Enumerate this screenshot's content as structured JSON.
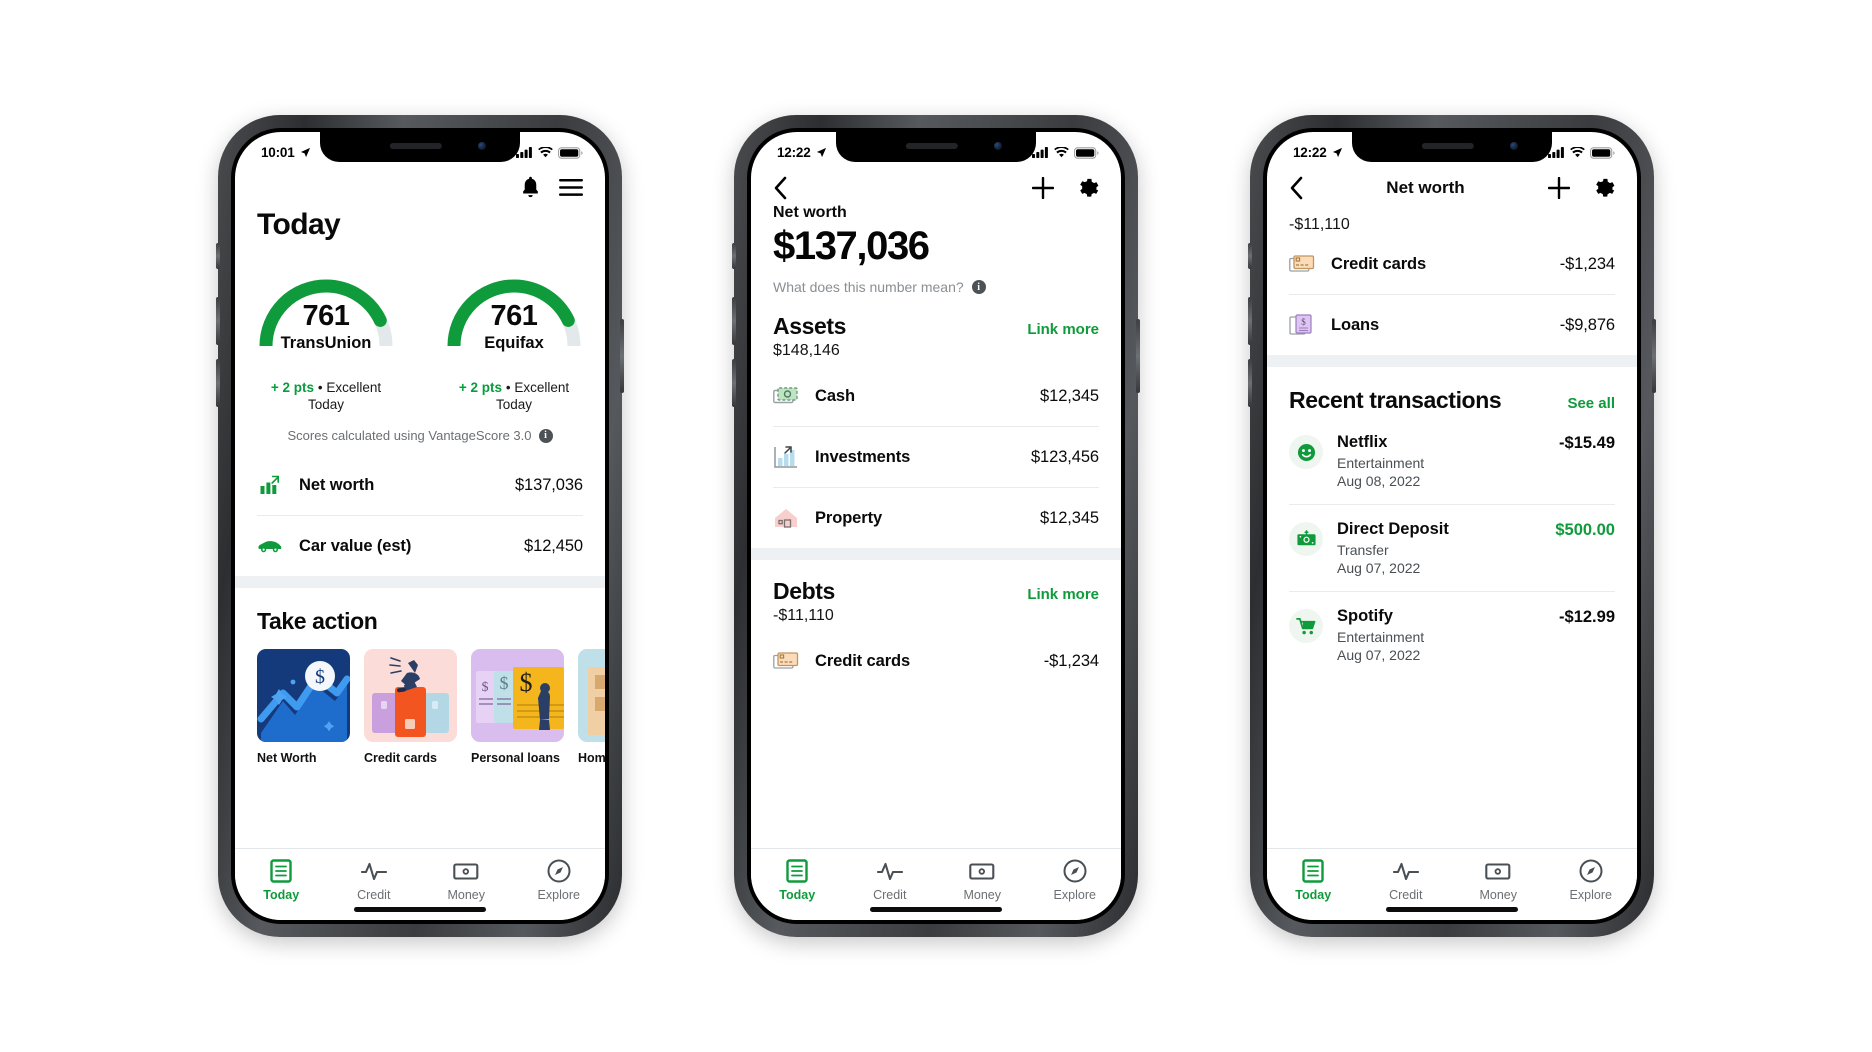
{
  "brand": {
    "green": "#0f9b3b",
    "green_dark": "#089c3c",
    "ink": "#0a0a0a",
    "muted": "#6b6f73",
    "divider": "#e8eaec",
    "section_bg": "#eef1f4"
  },
  "phone1": {
    "status": {
      "time": "10:01",
      "location_icon": "location-arrow-icon",
      "signal_icon": "cellular-signal-icon",
      "wifi_icon": "wifi-icon",
      "battery_icon": "battery-icon"
    },
    "topbar": {
      "bell_icon": "bell-icon",
      "menu_icon": "hamburger-menu-icon"
    },
    "title": "Today",
    "scores": [
      {
        "value": "761",
        "bureau": "TransUnion",
        "delta": "+ 2 pts",
        "separator": "•",
        "rating": "Excellent",
        "when": "Today",
        "percent": 86
      },
      {
        "value": "761",
        "bureau": "Equifax",
        "delta": "+ 2 pts",
        "separator": "•",
        "rating": "Excellent",
        "when": "Today",
        "percent": 86
      }
    ],
    "disclaimer": {
      "text": "Scores calculated using VantageScore 3.0",
      "icon": "info-icon",
      "glyph": "i"
    },
    "rows": [
      {
        "icon": "bar-chart-icon",
        "label": "Net worth",
        "value": "$137,036"
      },
      {
        "icon": "car-icon",
        "label": "Car value (est)",
        "value": "$12,450"
      }
    ],
    "take_action": {
      "title": "Take action",
      "cards": [
        {
          "label": "Net Worth",
          "art": "net-worth-chart-illustration"
        },
        {
          "label": "Credit cards",
          "art": "credit-cards-illustration"
        },
        {
          "label": "Personal loans",
          "art": "personal-loans-illustration"
        },
        {
          "label": "Home lo",
          "art": "home-loans-illustration"
        }
      ]
    },
    "tabs": [
      {
        "label": "Today",
        "icon": "document-icon",
        "active": true
      },
      {
        "label": "Credit",
        "icon": "pulse-icon",
        "active": false
      },
      {
        "label": "Money",
        "icon": "cash-icon",
        "active": false
      },
      {
        "label": "Explore",
        "icon": "compass-icon",
        "active": false
      }
    ]
  },
  "phone2": {
    "status": {
      "time": "12:22",
      "location_icon": "location-arrow-icon",
      "signal_icon": "cellular-signal-icon",
      "wifi_icon": "wifi-icon",
      "battery_icon": "battery-icon"
    },
    "topbar": {
      "back_icon": "back-chevron-icon",
      "plus_icon": "plus-icon",
      "gear_icon": "gear-icon"
    },
    "header": {
      "label": "Net worth",
      "amount": "$137,036",
      "help_text": "What does this number mean?",
      "help_icon": "info-icon",
      "help_glyph": "i"
    },
    "assets": {
      "title": "Assets",
      "link": "Link more",
      "total": "$148,146",
      "rows": [
        {
          "icon": "cash-icon",
          "label": "Cash",
          "value": "$12,345"
        },
        {
          "icon": "investments-chart-icon",
          "label": "Investments",
          "value": "$123,456"
        },
        {
          "icon": "house-icon",
          "label": "Property",
          "value": "$12,345"
        }
      ]
    },
    "debts": {
      "title": "Debts",
      "link": "Link more",
      "total": "-$11,110",
      "rows": [
        {
          "icon": "credit-card-icon",
          "label": "Credit cards",
          "value": "-$1,234"
        }
      ]
    },
    "tabs": [
      {
        "label": "Today",
        "icon": "document-icon",
        "active": true
      },
      {
        "label": "Credit",
        "icon": "pulse-icon",
        "active": false
      },
      {
        "label": "Money",
        "icon": "cash-icon",
        "active": false
      },
      {
        "label": "Explore",
        "icon": "compass-icon",
        "active": false
      }
    ]
  },
  "phone3": {
    "status": {
      "time": "12:22",
      "location_icon": "location-arrow-icon",
      "signal_icon": "cellular-signal-icon",
      "wifi_icon": "wifi-icon",
      "battery_icon": "battery-icon"
    },
    "navbar": {
      "back_icon": "back-chevron-icon",
      "title": "Net worth",
      "plus_icon": "plus-icon",
      "gear_icon": "gear-icon"
    },
    "debts_total": "-$11,110",
    "debt_rows": [
      {
        "icon": "credit-card-icon",
        "label": "Credit cards",
        "value": "-$1,234"
      },
      {
        "icon": "loans-icon",
        "label": "Loans",
        "value": "-$9,876"
      }
    ],
    "transactions": {
      "title": "Recent transactions",
      "link": "See all",
      "items": [
        {
          "icon": "smiley-icon",
          "name": "Netflix",
          "category": "Entertainment",
          "date": "Aug 08, 2022",
          "amount": "-$15.49",
          "positive": false
        },
        {
          "icon": "deposit-cash-icon",
          "name": "Direct Deposit",
          "category": "Transfer",
          "date": "Aug 07, 2022",
          "amount": "$500.00",
          "positive": true
        },
        {
          "icon": "shopping-cart-icon",
          "name": "Spotify",
          "category": "Entertainment",
          "date": "Aug 07, 2022",
          "amount": "-$12.99",
          "positive": false
        }
      ]
    },
    "tabs": [
      {
        "label": "Today",
        "icon": "document-icon",
        "active": true
      },
      {
        "label": "Credit",
        "icon": "pulse-icon",
        "active": false
      },
      {
        "label": "Money",
        "icon": "cash-icon",
        "active": false
      },
      {
        "label": "Explore",
        "icon": "compass-icon",
        "active": false
      }
    ]
  }
}
